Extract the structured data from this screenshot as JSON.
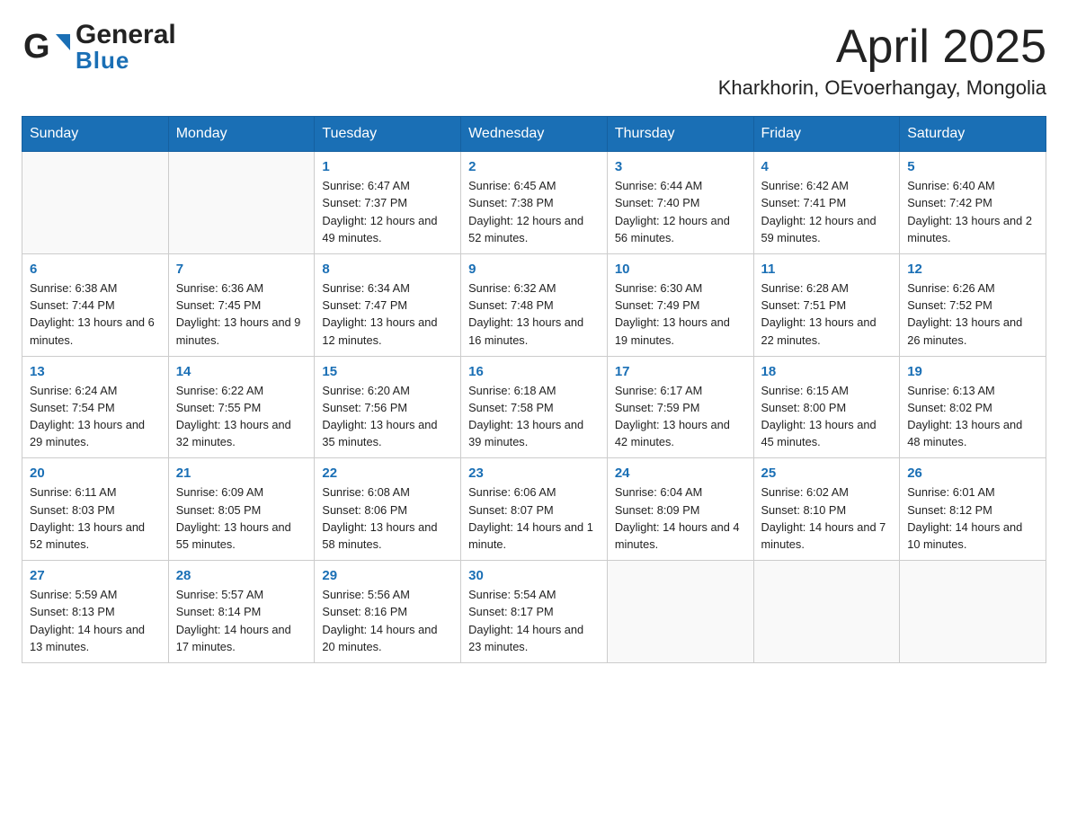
{
  "header": {
    "title": "April 2025",
    "subtitle": "Kharkhorin, OEvoerhangay, Mongolia",
    "logo_general": "General",
    "logo_blue": "Blue"
  },
  "weekdays": [
    "Sunday",
    "Monday",
    "Tuesday",
    "Wednesday",
    "Thursday",
    "Friday",
    "Saturday"
  ],
  "weeks": [
    [
      {
        "day": "",
        "sunrise": "",
        "sunset": "",
        "daylight": ""
      },
      {
        "day": "",
        "sunrise": "",
        "sunset": "",
        "daylight": ""
      },
      {
        "day": "1",
        "sunrise": "Sunrise: 6:47 AM",
        "sunset": "Sunset: 7:37 PM",
        "daylight": "Daylight: 12 hours and 49 minutes."
      },
      {
        "day": "2",
        "sunrise": "Sunrise: 6:45 AM",
        "sunset": "Sunset: 7:38 PM",
        "daylight": "Daylight: 12 hours and 52 minutes."
      },
      {
        "day": "3",
        "sunrise": "Sunrise: 6:44 AM",
        "sunset": "Sunset: 7:40 PM",
        "daylight": "Daylight: 12 hours and 56 minutes."
      },
      {
        "day": "4",
        "sunrise": "Sunrise: 6:42 AM",
        "sunset": "Sunset: 7:41 PM",
        "daylight": "Daylight: 12 hours and 59 minutes."
      },
      {
        "day": "5",
        "sunrise": "Sunrise: 6:40 AM",
        "sunset": "Sunset: 7:42 PM",
        "daylight": "Daylight: 13 hours and 2 minutes."
      }
    ],
    [
      {
        "day": "6",
        "sunrise": "Sunrise: 6:38 AM",
        "sunset": "Sunset: 7:44 PM",
        "daylight": "Daylight: 13 hours and 6 minutes."
      },
      {
        "day": "7",
        "sunrise": "Sunrise: 6:36 AM",
        "sunset": "Sunset: 7:45 PM",
        "daylight": "Daylight: 13 hours and 9 minutes."
      },
      {
        "day": "8",
        "sunrise": "Sunrise: 6:34 AM",
        "sunset": "Sunset: 7:47 PM",
        "daylight": "Daylight: 13 hours and 12 minutes."
      },
      {
        "day": "9",
        "sunrise": "Sunrise: 6:32 AM",
        "sunset": "Sunset: 7:48 PM",
        "daylight": "Daylight: 13 hours and 16 minutes."
      },
      {
        "day": "10",
        "sunrise": "Sunrise: 6:30 AM",
        "sunset": "Sunset: 7:49 PM",
        "daylight": "Daylight: 13 hours and 19 minutes."
      },
      {
        "day": "11",
        "sunrise": "Sunrise: 6:28 AM",
        "sunset": "Sunset: 7:51 PM",
        "daylight": "Daylight: 13 hours and 22 minutes."
      },
      {
        "day": "12",
        "sunrise": "Sunrise: 6:26 AM",
        "sunset": "Sunset: 7:52 PM",
        "daylight": "Daylight: 13 hours and 26 minutes."
      }
    ],
    [
      {
        "day": "13",
        "sunrise": "Sunrise: 6:24 AM",
        "sunset": "Sunset: 7:54 PM",
        "daylight": "Daylight: 13 hours and 29 minutes."
      },
      {
        "day": "14",
        "sunrise": "Sunrise: 6:22 AM",
        "sunset": "Sunset: 7:55 PM",
        "daylight": "Daylight: 13 hours and 32 minutes."
      },
      {
        "day": "15",
        "sunrise": "Sunrise: 6:20 AM",
        "sunset": "Sunset: 7:56 PM",
        "daylight": "Daylight: 13 hours and 35 minutes."
      },
      {
        "day": "16",
        "sunrise": "Sunrise: 6:18 AM",
        "sunset": "Sunset: 7:58 PM",
        "daylight": "Daylight: 13 hours and 39 minutes."
      },
      {
        "day": "17",
        "sunrise": "Sunrise: 6:17 AM",
        "sunset": "Sunset: 7:59 PM",
        "daylight": "Daylight: 13 hours and 42 minutes."
      },
      {
        "day": "18",
        "sunrise": "Sunrise: 6:15 AM",
        "sunset": "Sunset: 8:00 PM",
        "daylight": "Daylight: 13 hours and 45 minutes."
      },
      {
        "day": "19",
        "sunrise": "Sunrise: 6:13 AM",
        "sunset": "Sunset: 8:02 PM",
        "daylight": "Daylight: 13 hours and 48 minutes."
      }
    ],
    [
      {
        "day": "20",
        "sunrise": "Sunrise: 6:11 AM",
        "sunset": "Sunset: 8:03 PM",
        "daylight": "Daylight: 13 hours and 52 minutes."
      },
      {
        "day": "21",
        "sunrise": "Sunrise: 6:09 AM",
        "sunset": "Sunset: 8:05 PM",
        "daylight": "Daylight: 13 hours and 55 minutes."
      },
      {
        "day": "22",
        "sunrise": "Sunrise: 6:08 AM",
        "sunset": "Sunset: 8:06 PM",
        "daylight": "Daylight: 13 hours and 58 minutes."
      },
      {
        "day": "23",
        "sunrise": "Sunrise: 6:06 AM",
        "sunset": "Sunset: 8:07 PM",
        "daylight": "Daylight: 14 hours and 1 minute."
      },
      {
        "day": "24",
        "sunrise": "Sunrise: 6:04 AM",
        "sunset": "Sunset: 8:09 PM",
        "daylight": "Daylight: 14 hours and 4 minutes."
      },
      {
        "day": "25",
        "sunrise": "Sunrise: 6:02 AM",
        "sunset": "Sunset: 8:10 PM",
        "daylight": "Daylight: 14 hours and 7 minutes."
      },
      {
        "day": "26",
        "sunrise": "Sunrise: 6:01 AM",
        "sunset": "Sunset: 8:12 PM",
        "daylight": "Daylight: 14 hours and 10 minutes."
      }
    ],
    [
      {
        "day": "27",
        "sunrise": "Sunrise: 5:59 AM",
        "sunset": "Sunset: 8:13 PM",
        "daylight": "Daylight: 14 hours and 13 minutes."
      },
      {
        "day": "28",
        "sunrise": "Sunrise: 5:57 AM",
        "sunset": "Sunset: 8:14 PM",
        "daylight": "Daylight: 14 hours and 17 minutes."
      },
      {
        "day": "29",
        "sunrise": "Sunrise: 5:56 AM",
        "sunset": "Sunset: 8:16 PM",
        "daylight": "Daylight: 14 hours and 20 minutes."
      },
      {
        "day": "30",
        "sunrise": "Sunrise: 5:54 AM",
        "sunset": "Sunset: 8:17 PM",
        "daylight": "Daylight: 14 hours and 23 minutes."
      },
      {
        "day": "",
        "sunrise": "",
        "sunset": "",
        "daylight": ""
      },
      {
        "day": "",
        "sunrise": "",
        "sunset": "",
        "daylight": ""
      },
      {
        "day": "",
        "sunrise": "",
        "sunset": "",
        "daylight": ""
      }
    ]
  ]
}
